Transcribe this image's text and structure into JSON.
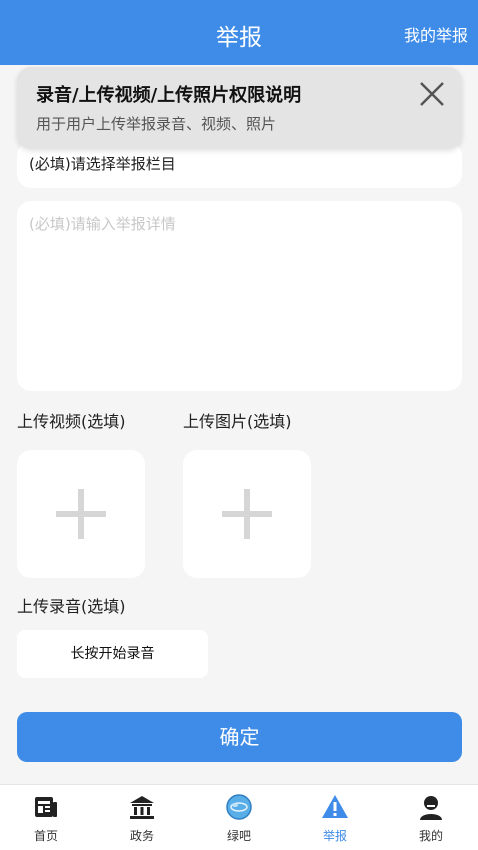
{
  "header": {
    "title": "举报",
    "right_link": "我的举报"
  },
  "permission_popup": {
    "title": "录音/上传视频/上传照片权限说明",
    "description": "用于用户上传举报录音、视频、照片"
  },
  "form": {
    "category_text": "(必填)请选择举报栏目",
    "details_placeholder": "(必填)请输入举报详情",
    "video_label": "上传视频(选填)",
    "image_label": "上传图片(选填)",
    "audio_label": "上传录音(选填)",
    "record_button": "长按开始录音",
    "confirm_button": "确定"
  },
  "tabs": [
    {
      "label": "首页",
      "icon": "news-icon",
      "active": false
    },
    {
      "label": "政务",
      "icon": "government-building-icon",
      "active": false
    },
    {
      "label": "绿吧",
      "icon": "globe-icon",
      "active": false
    },
    {
      "label": "举报",
      "icon": "warning-icon",
      "active": true
    },
    {
      "label": "我的",
      "icon": "user-icon",
      "active": false
    }
  ],
  "colors": {
    "accent": "#3f8ce8",
    "background": "#f5f5f5"
  }
}
